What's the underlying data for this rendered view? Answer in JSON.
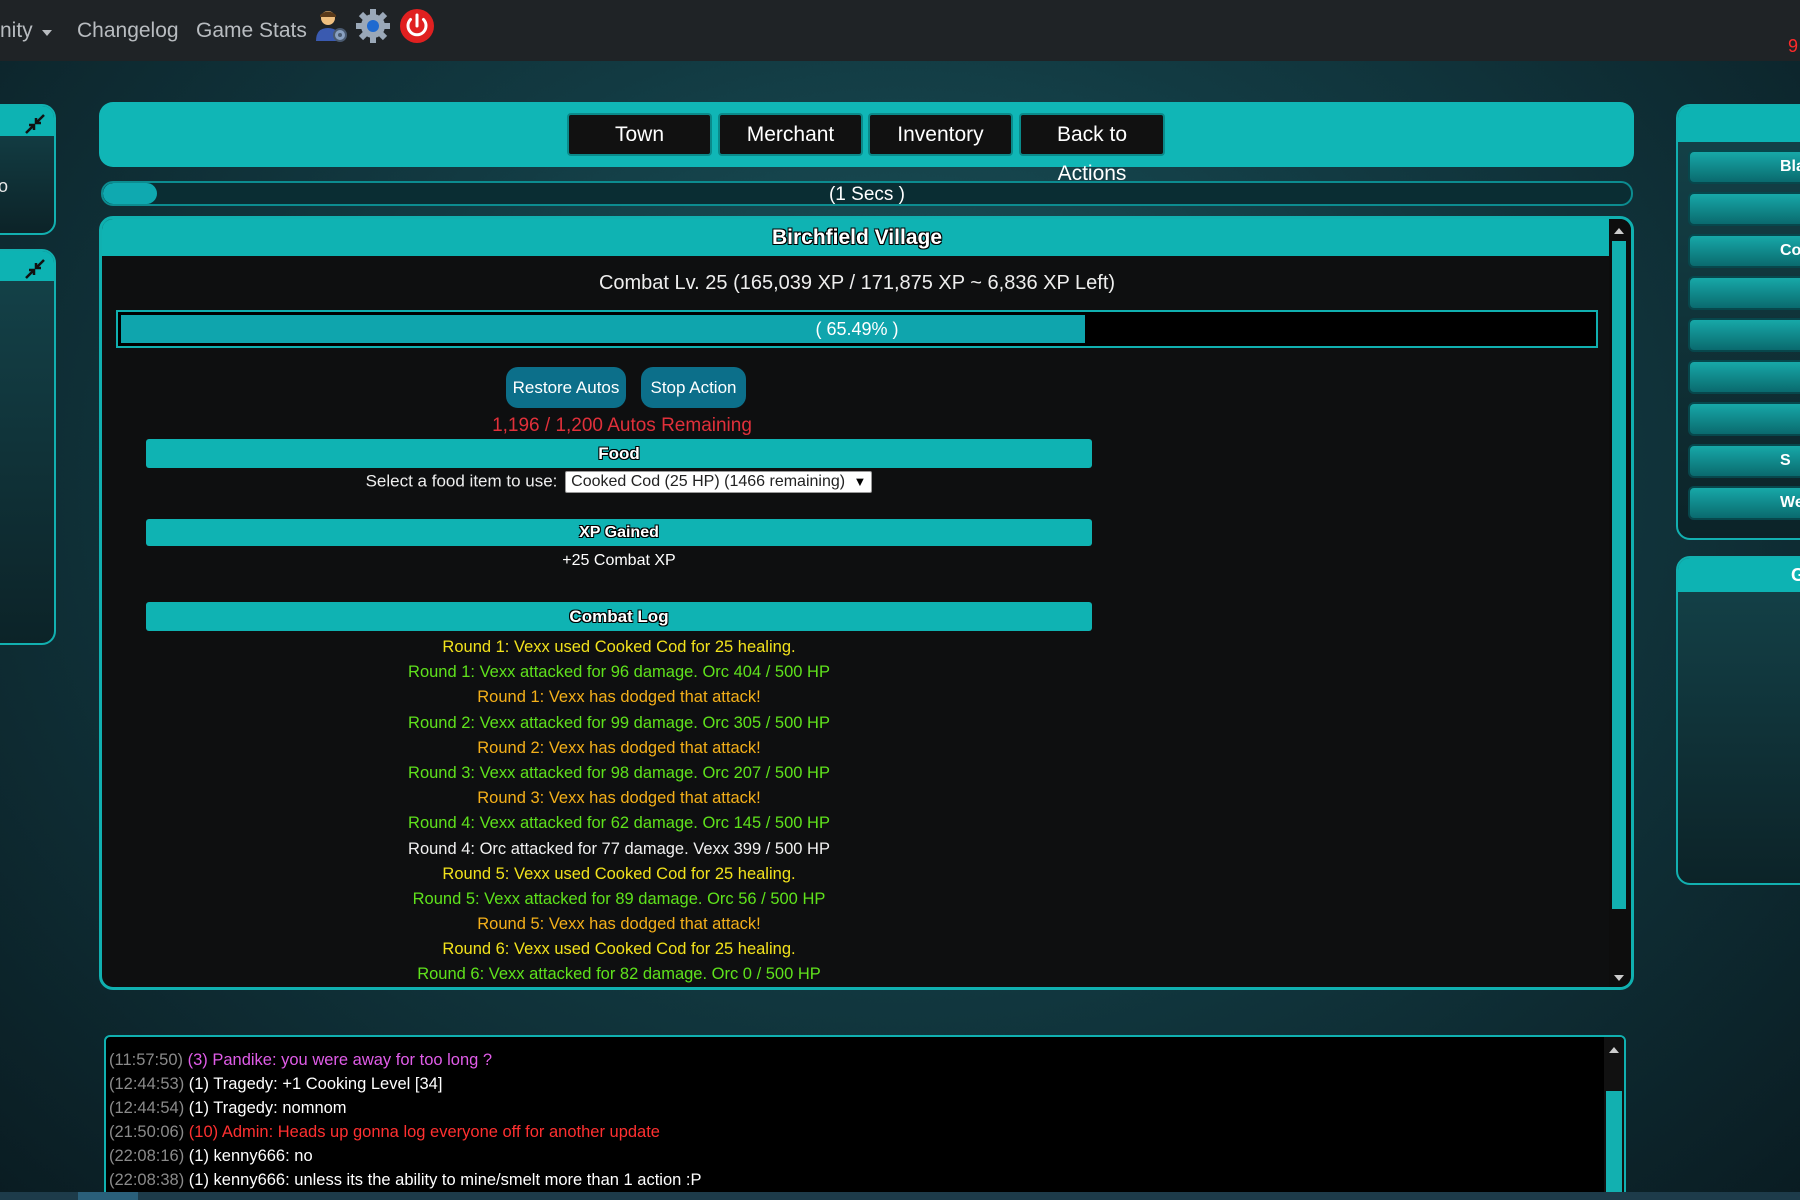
{
  "nav": {
    "community_label": "nity",
    "changelog_label": "Changelog",
    "game_stats_label": "Game Stats",
    "corner_text": "9"
  },
  "icons": {
    "profile": "user-gear-icon",
    "settings": "gear-icon",
    "power": "power-icon",
    "minimize": "minimize-icon"
  },
  "left_panel": {
    "partial_text": "o"
  },
  "right_panel": {
    "buttons": [
      "Bla",
      "",
      "Co",
      "",
      "",
      "",
      "",
      "S",
      "We"
    ],
    "lower_head": "G"
  },
  "actions": {
    "town": "Town",
    "merchant": "Merchant",
    "inventory": "Inventory",
    "back": "Back to Actions"
  },
  "timer": {
    "text": "(1 Secs )",
    "progress_fraction": 0.03
  },
  "main": {
    "title": "Birchfield Village",
    "combat_level": "Combat Lv. 25 (165,039 XP / 171,875 XP ~ 6,836 XP Left)",
    "xp_progress_text": "( 65.49% )",
    "xp_progress_percent": 65.49,
    "restore_autos": "Restore Autos",
    "stop_action": "Stop Action",
    "autos_remaining": "1,196 / 1,200 Autos Remaining",
    "food_header": "Food",
    "food_label": "Select a food item to use:",
    "food_selected": "Cooked Cod (25 HP) (1466 remaining)",
    "xp_header": "XP Gained",
    "xp_gained": "+25 Combat XP",
    "log_header": "Combat Log",
    "log": [
      {
        "text": "Round 1: Vexx used Cooked Cod for 25 healing.",
        "color": "#f2e21c"
      },
      {
        "text": "Round 1: Vexx attacked for 96 damage. Orc 404 / 500 HP",
        "color": "#5fe21c"
      },
      {
        "text": "Round 1: Vexx has dodged that attack!",
        "color": "#f4b01a"
      },
      {
        "text": "Round 2: Vexx attacked for 99 damage. Orc 305 / 500 HP",
        "color": "#5fe21c"
      },
      {
        "text": "Round 2: Vexx has dodged that attack!",
        "color": "#f4b01a"
      },
      {
        "text": "Round 3: Vexx attacked for 98 damage. Orc 207 / 500 HP",
        "color": "#5fe21c"
      },
      {
        "text": "Round 3: Vexx has dodged that attack!",
        "color": "#f4b01a"
      },
      {
        "text": "Round 4: Vexx attacked for 62 damage. Orc 145 / 500 HP",
        "color": "#5fe21c"
      },
      {
        "text": "Round 4: Orc attacked for 77 damage. Vexx 399 / 500 HP",
        "color": "#f0f0f0"
      },
      {
        "text": "Round 5: Vexx used Cooked Cod for 25 healing.",
        "color": "#f2e21c"
      },
      {
        "text": "Round 5: Vexx attacked for 89 damage. Orc 56 / 500 HP",
        "color": "#5fe21c"
      },
      {
        "text": "Round 5: Vexx has dodged that attack!",
        "color": "#f4b01a"
      },
      {
        "text": "Round 6: Vexx used Cooked Cod for 25 healing.",
        "color": "#f2e21c"
      },
      {
        "text": "Round 6: Vexx attacked for 82 damage. Orc 0 / 500 HP",
        "color": "#5fe21c"
      }
    ]
  },
  "chat": [
    {
      "time": "(11:57:50)",
      "text": "(3) Pandike: you were away for too long ?",
      "color": "#e05ce8"
    },
    {
      "time": "(12:44:53)",
      "text": "(1) Tragedy: +1 Cooking Level [34]",
      "color": "#ffffff"
    },
    {
      "time": "(12:44:54)",
      "text": "(1) Tragedy: nomnom",
      "color": "#ffffff"
    },
    {
      "time": "(21:50:06)",
      "text": "(10) Admin: Heads up gonna log everyone off for another update",
      "color": "#ff3030"
    },
    {
      "time": "(22:08:16)",
      "text": "(1) kenny666: no",
      "color": "#ffffff"
    },
    {
      "time": "(22:08:38)",
      "text": "(1) kenny666: unless its the ability to mine/smelt more than 1 action :P",
      "color": "#ffffff"
    }
  ],
  "colors": {
    "accent": "#10b3b3",
    "autos_red": "#e0303a"
  }
}
